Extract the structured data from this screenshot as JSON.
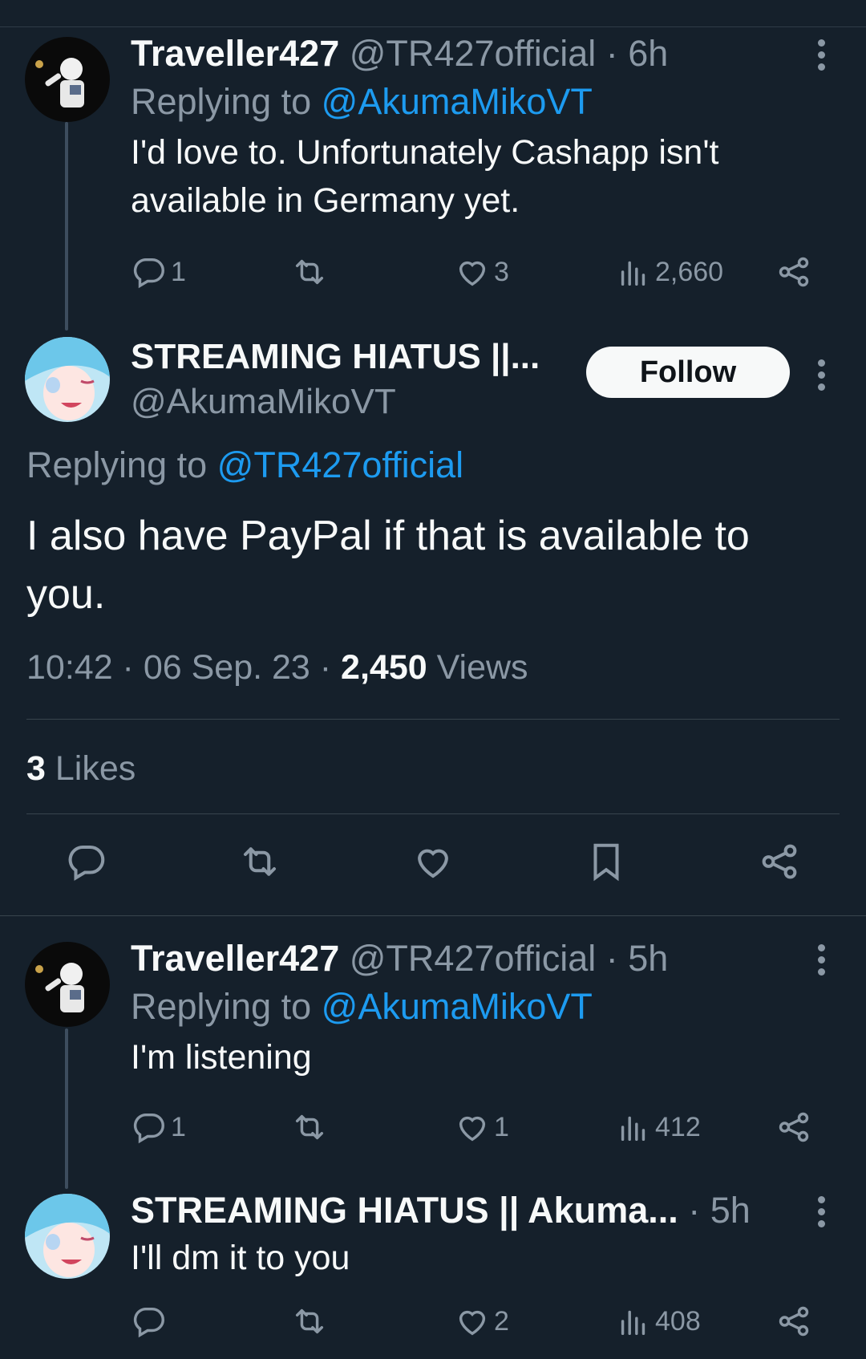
{
  "tweet1": {
    "name": "Traveller427",
    "meta": "@TR427official · 6h",
    "reply_prefix": "Replying to",
    "reply_to": "@AkumaMikoVT",
    "text": "I'd love to. Unfortunately Cashapp isn't available in Germany yet.",
    "replies": "1",
    "likes": "3",
    "views": "2,660"
  },
  "main": {
    "name": "STREAMING HIATUS ||...",
    "handle": "@AkumaMikoVT",
    "follow_label": "Follow",
    "reply_prefix": "Replying to",
    "reply_to": "@TR427official",
    "text": "I also have PayPal if that is available to you.",
    "timestamp": "10:42 · 06 Sep. 23 ·",
    "views_count": "2,450",
    "views_label": "Views",
    "likes_count": "3",
    "likes_label": "Likes"
  },
  "tweet2": {
    "name": "Traveller427",
    "meta": "@TR427official · 5h",
    "reply_prefix": "Replying to",
    "reply_to": "@AkumaMikoVT",
    "text": "I'm listening",
    "replies": "1",
    "likes": "1",
    "views": "412"
  },
  "tweet3": {
    "name": "STREAMING HIATUS || Akuma...",
    "meta": "· 5h",
    "text": "I'll dm it to you",
    "likes": "2",
    "views": "408"
  },
  "colors": {
    "background": "#15202b",
    "link": "#1d9bf0",
    "muted": "#8b98a5",
    "text": "#f7f9f9"
  },
  "icons": [
    "reply-icon",
    "retweet-icon",
    "like-icon",
    "views-icon",
    "share-icon",
    "bookmark-icon",
    "more-icon"
  ]
}
